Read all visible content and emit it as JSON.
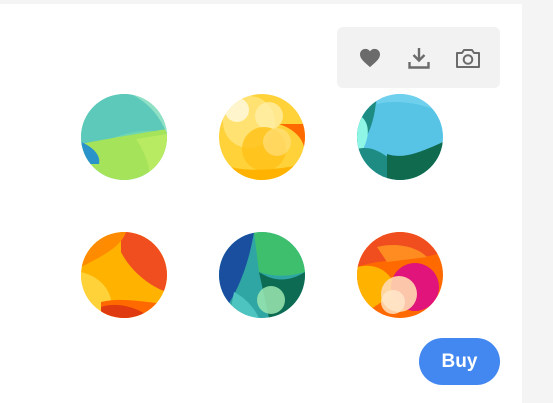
{
  "toolbar": {
    "icons": [
      "heart-icon",
      "download-icon",
      "camera-icon"
    ]
  },
  "gallery": {
    "items": [
      {
        "name": "artwork-1",
        "colors": [
          "#5fd0b0",
          "#a4e35a",
          "#2a93c9"
        ]
      },
      {
        "name": "artwork-2",
        "colors": [
          "#ffd23a",
          "#ffb300",
          "#ff6a00"
        ]
      },
      {
        "name": "artwork-3",
        "colors": [
          "#57c4e6",
          "#1f8c84",
          "#0f6a4e"
        ]
      },
      {
        "name": "artwork-4",
        "colors": [
          "#ffb300",
          "#f04e1e",
          "#ffd23a"
        ]
      },
      {
        "name": "artwork-5",
        "colors": [
          "#1a4fa0",
          "#3dbf6e",
          "#0c6b52"
        ]
      },
      {
        "name": "artwork-6",
        "colors": [
          "#ff6a00",
          "#e0147a",
          "#ffd9b0"
        ]
      }
    ]
  },
  "actions": {
    "buy_label": "Buy"
  },
  "colors": {
    "accent": "#4387f0",
    "icon": "#6b6b6b",
    "toolbar_bg": "#f2f2f3"
  }
}
